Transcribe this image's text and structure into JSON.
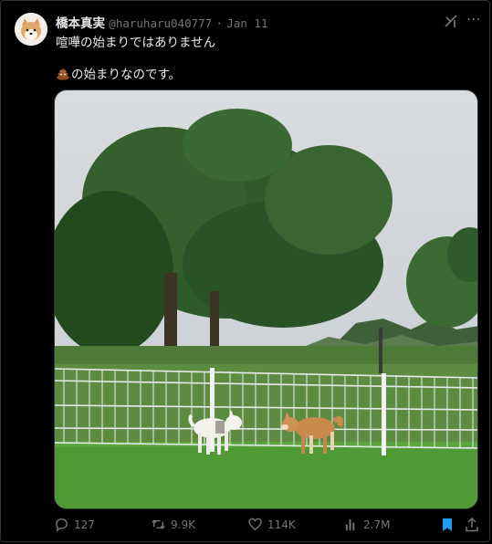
{
  "tweet": {
    "author_name": "橋本真実",
    "handle": "@haruharu040777",
    "separator": "·",
    "date": "Jan 11",
    "text_line1": "喧嘩の始まりではありません",
    "text_line2": "の始まりなのです。",
    "emoji": "poo-icon",
    "menu_glyph": "⋯"
  },
  "actions": {
    "replies": "127",
    "reposts": "9.9K",
    "likes": "114K",
    "views": "2.7M"
  },
  "colors": {
    "background": "#000000",
    "text": "#e7e9ea",
    "muted": "#71767b",
    "bookmark_active": "#1d9bf0",
    "border": "#2f3336"
  }
}
